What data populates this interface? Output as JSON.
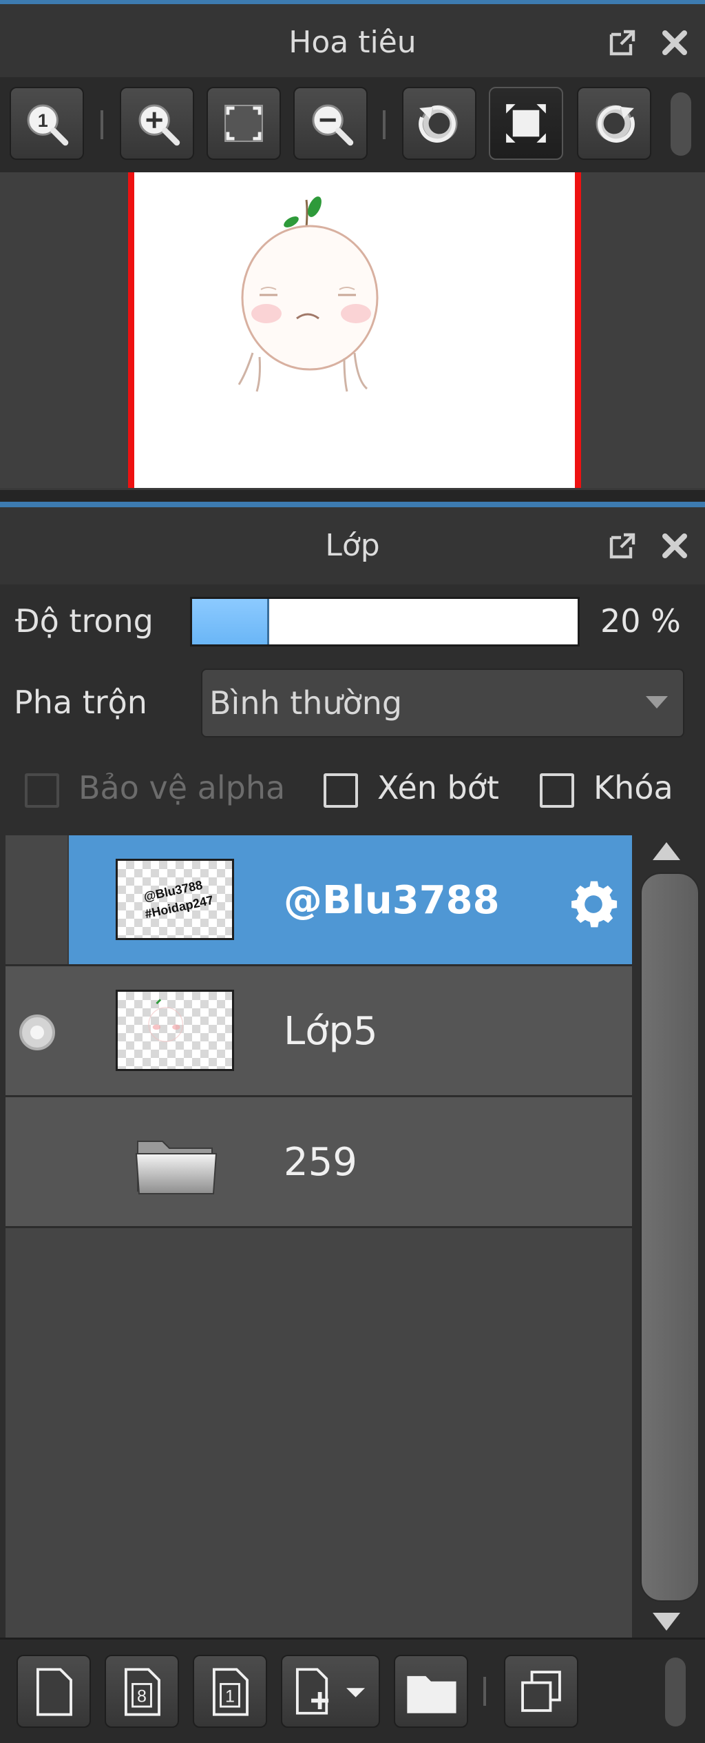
{
  "navigator": {
    "title": "Hoa tiêu",
    "toolbar": {
      "buttons": [
        {
          "name": "zoom-actual-size",
          "icon": "zoom-1-to-1-icon"
        },
        {
          "name": "zoom-in",
          "icon": "zoom-in-icon"
        },
        {
          "name": "fit-to-window",
          "icon": "fit-window-icon"
        },
        {
          "name": "zoom-out",
          "icon": "zoom-out-icon"
        },
        {
          "name": "rotate-left",
          "icon": "rotate-left-icon"
        },
        {
          "name": "reset-view",
          "icon": "reset-view-icon"
        },
        {
          "name": "rotate-right",
          "icon": "rotate-right-icon"
        }
      ]
    }
  },
  "layers": {
    "title": "Lớp",
    "opacity_label": "Độ trong",
    "opacity_percent": 20,
    "opacity_text": "20 %",
    "blend_label": "Pha trộn",
    "blend_value": "Bình thường",
    "protect_alpha_label": "Bảo vệ alpha",
    "clipping_label": "Xén bớt",
    "lock_label": "Khóa",
    "items": [
      {
        "name": "@Blu3788",
        "thumb_text_line1": "@Blu3788",
        "thumb_text_line2": "#Hoidap247",
        "selected": true
      },
      {
        "name": "Lớp5",
        "selected": false
      },
      {
        "name": "259",
        "type": "folder",
        "selected": false
      }
    ]
  },
  "colors": {
    "accent": "#4f97d4",
    "canvas_border": "#ee1111",
    "opacity_fill": "#6ab6f6"
  }
}
